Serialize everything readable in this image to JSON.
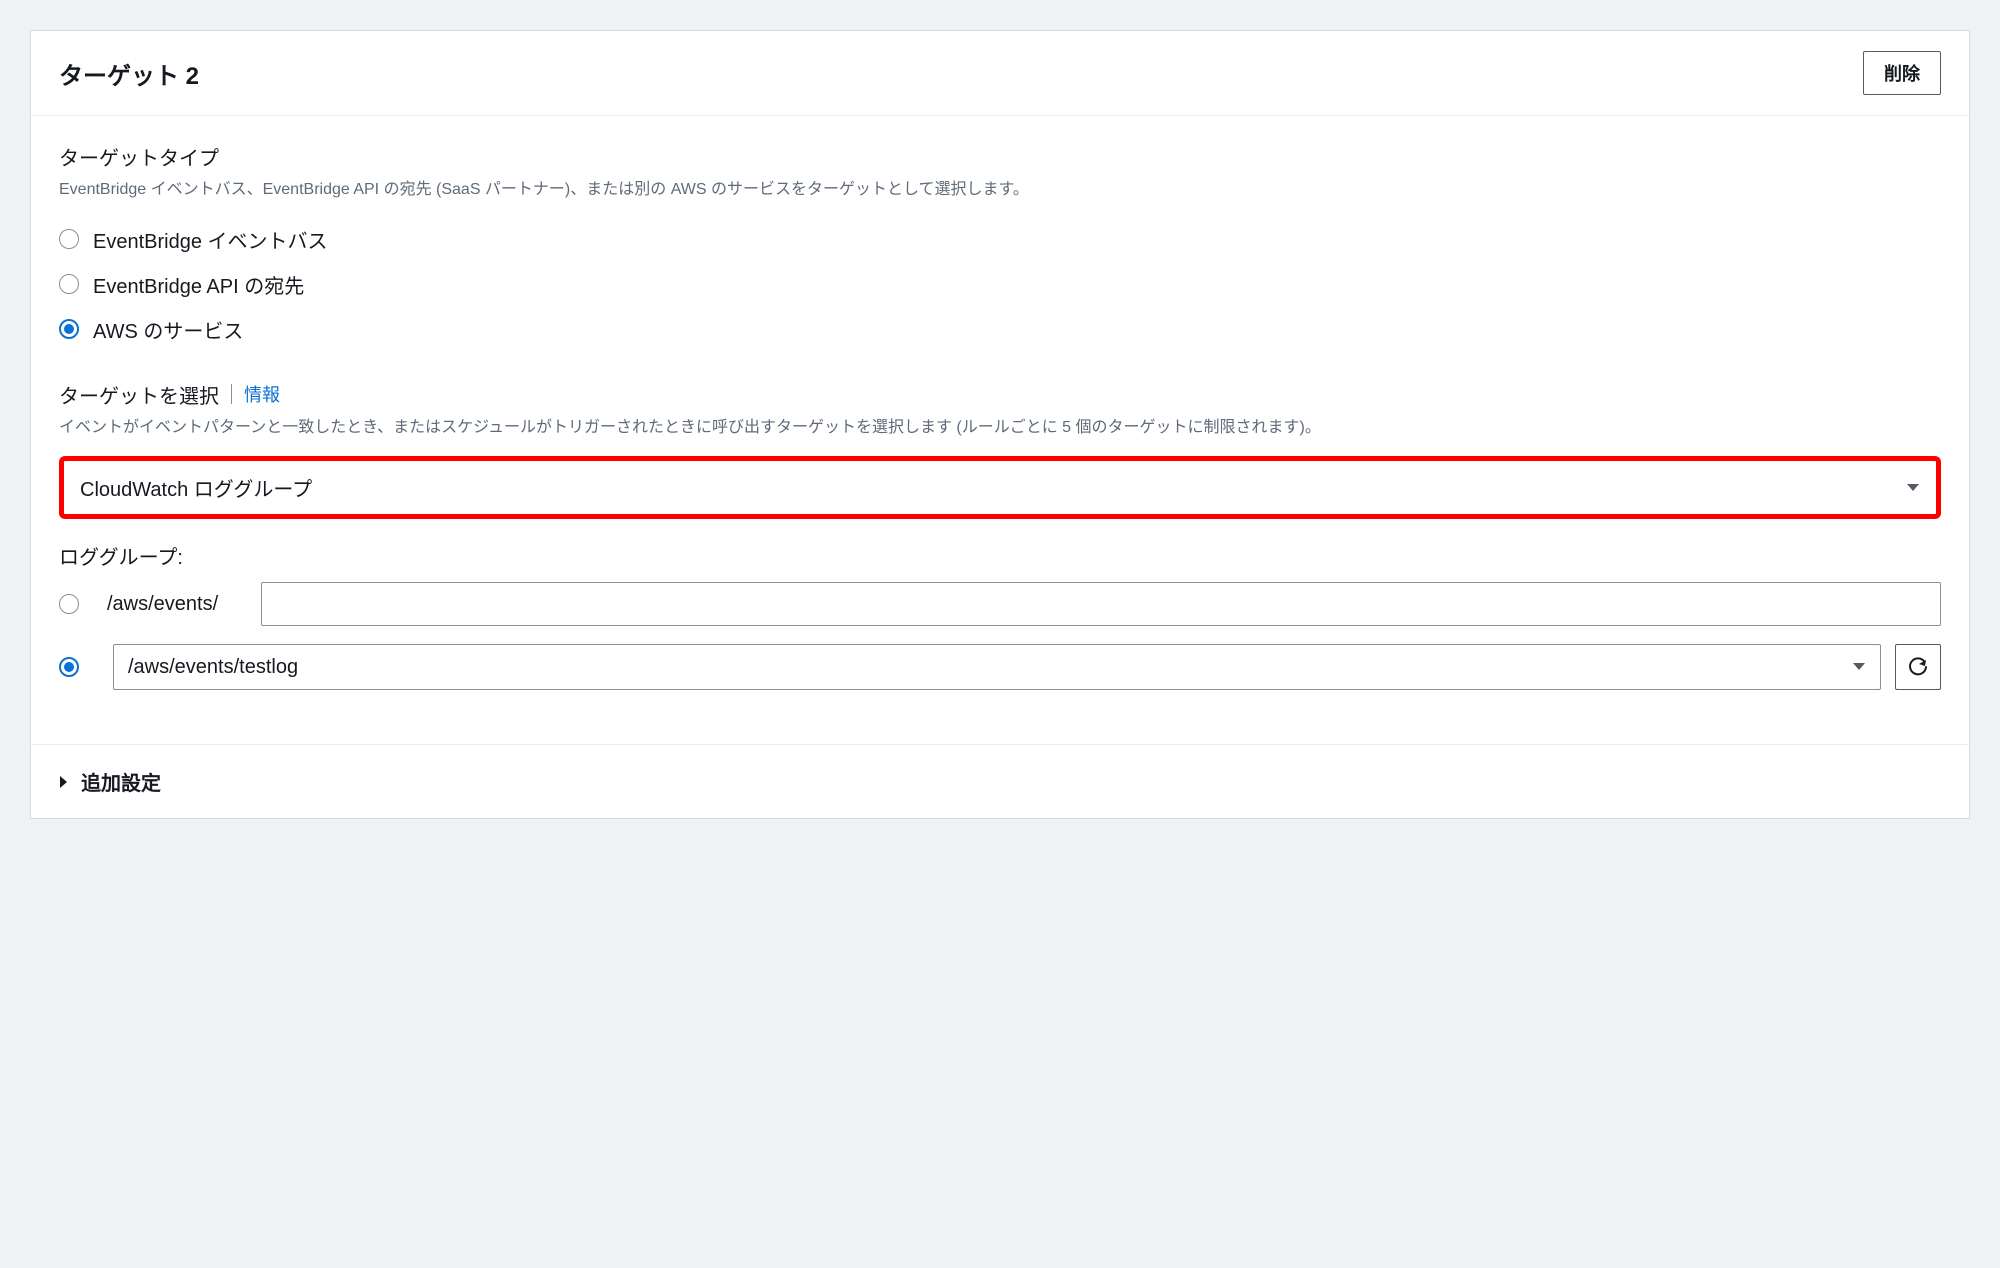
{
  "panel": {
    "title": "ターゲット 2",
    "delete_label": "削除"
  },
  "target_type": {
    "heading": "ターゲットタイプ",
    "description": "EventBridge イベントバス、EventBridge API の宛先 (SaaS パートナー)、または別の AWS のサービスをターゲットとして選択します。",
    "options": [
      {
        "label": "EventBridge イベントバス",
        "selected": false
      },
      {
        "label": "EventBridge API の宛先",
        "selected": false
      },
      {
        "label": "AWS のサービス",
        "selected": true
      }
    ]
  },
  "select_target": {
    "heading": "ターゲットを選択",
    "info_link": "情報",
    "description": "イベントがイベントパターンと一致したとき、またはスケジュールがトリガーされたときに呼び出すターゲットを選択します (ルールごとに 5 個のターゲットに制限されます)。",
    "selected_value": "CloudWatch ロググループ"
  },
  "log_group": {
    "label": "ロググループ:",
    "new_option": {
      "prefix": "/aws/events/",
      "value": "",
      "selected": false
    },
    "existing_option": {
      "value": "/aws/events/testlog",
      "selected": true
    }
  },
  "additional": {
    "label": "追加設定"
  }
}
